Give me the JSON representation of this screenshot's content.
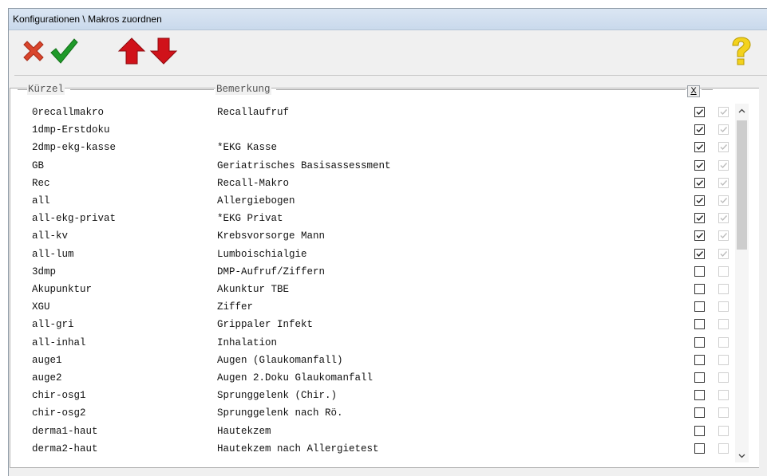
{
  "window": {
    "title": "Konfigurationen \\ Makros zuordnen"
  },
  "toolbar": {
    "buttons": [
      {
        "name": "cancel",
        "icon": "red-x-icon"
      },
      {
        "name": "confirm",
        "icon": "green-check-icon"
      },
      {
        "name": "move-up",
        "icon": "red-arrow-up-icon"
      },
      {
        "name": "move-down",
        "icon": "red-arrow-down-icon"
      },
      {
        "name": "help",
        "icon": "question-mark-icon"
      }
    ]
  },
  "table": {
    "headers": {
      "code": "Kürzel",
      "note": "Bemerkung",
      "x": "X"
    },
    "rows": [
      {
        "code": "0recallmakro",
        "note": "Recallaufruf",
        "checked": true
      },
      {
        "code": "1dmp-Erstdoku",
        "note": "",
        "checked": true
      },
      {
        "code": "2dmp-ekg-kasse",
        "note": "*EKG Kasse",
        "checked": true
      },
      {
        "code": "GB",
        "note": "Geriatrisches Basisassessment",
        "checked": true
      },
      {
        "code": "Rec",
        "note": "Recall-Makro",
        "checked": true
      },
      {
        "code": "all",
        "note": "Allergiebogen",
        "checked": true
      },
      {
        "code": "all-ekg-privat",
        "note": "*EKG Privat",
        "checked": true
      },
      {
        "code": "all-kv",
        "note": "Krebsvorsorge Mann",
        "checked": true
      },
      {
        "code": "all-lum",
        "note": "Lumboischialgie",
        "checked": true
      },
      {
        "code": "3dmp",
        "note": "DMP-Aufruf/Ziffern",
        "checked": false
      },
      {
        "code": "Akupunktur",
        "note": "Akunktur TBE",
        "checked": false
      },
      {
        "code": "XGU",
        "note": "Ziffer",
        "checked": false
      },
      {
        "code": "all-gri",
        "note": "Grippaler Infekt",
        "checked": false
      },
      {
        "code": "all-inhal",
        "note": "Inhalation",
        "checked": false
      },
      {
        "code": "auge1",
        "note": "Augen (Glaukomanfall)",
        "checked": false
      },
      {
        "code": "auge2",
        "note": "Augen 2.Doku Glaukomanfall",
        "checked": false
      },
      {
        "code": "chir-osg1",
        "note": "Sprunggelenk (Chir.)",
        "checked": false
      },
      {
        "code": "chir-osg2",
        "note": "Sprunggelenk nach Rö.",
        "checked": false
      },
      {
        "code": "derma1-haut",
        "note": "Hautekzem",
        "checked": false
      },
      {
        "code": "derma2-haut",
        "note": "Hautekzem nach Allergietest",
        "checked": false
      }
    ]
  }
}
